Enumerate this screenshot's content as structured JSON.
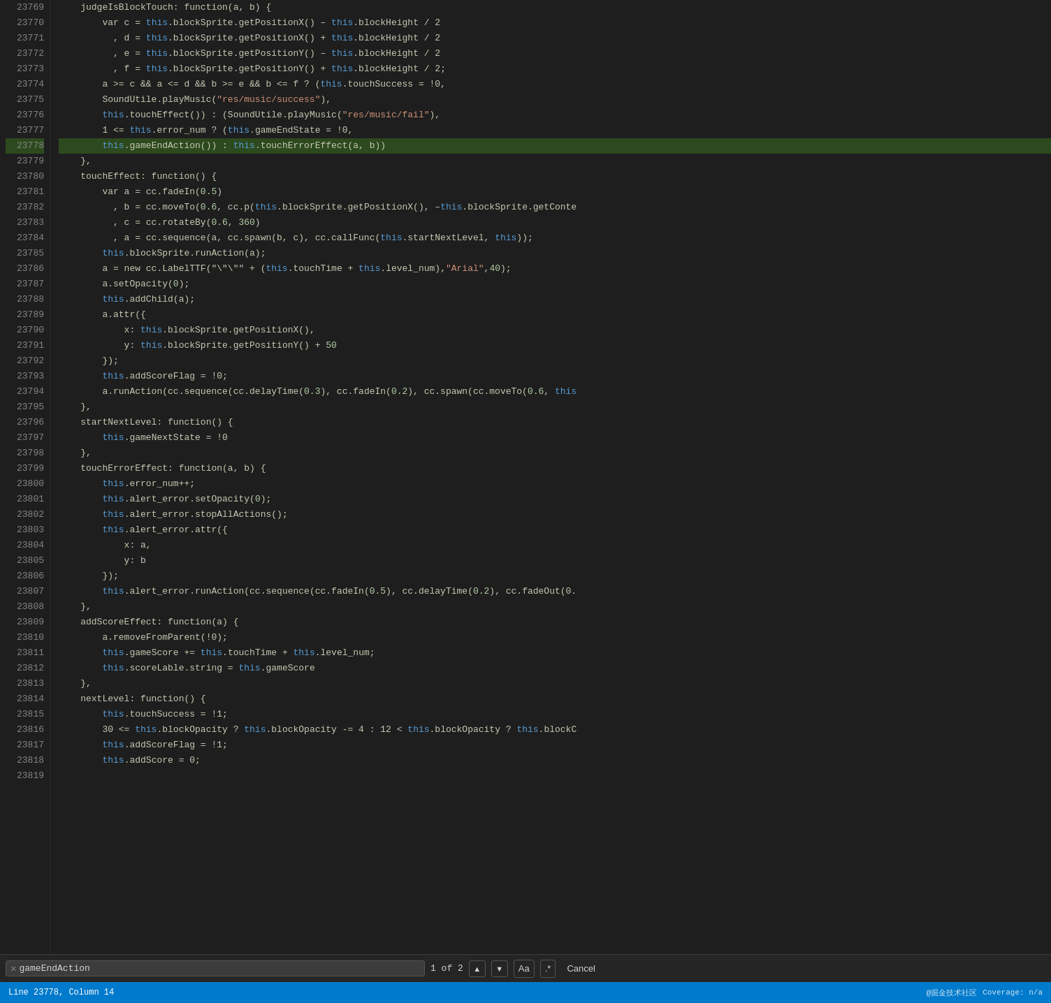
{
  "lines": [
    {
      "num": 23769,
      "tokens": [
        {
          "t": "    judgeIsBlockTouch: function(a, b) {",
          "c": ""
        }
      ]
    },
    {
      "num": 23770,
      "tokens": [
        {
          "t": "        var c = ",
          "c": ""
        },
        {
          "t": "this",
          "c": "this-kw"
        },
        {
          "t": ".blockSprite.getPositionX() – ",
          "c": ""
        },
        {
          "t": "this",
          "c": "this-kw"
        },
        {
          "t": ".blockHeight / 2",
          "c": ""
        }
      ]
    },
    {
      "num": 23771,
      "tokens": [
        {
          "t": "          , d = ",
          "c": ""
        },
        {
          "t": "this",
          "c": "this-kw"
        },
        {
          "t": ".blockSprite.getPositionX() + ",
          "c": ""
        },
        {
          "t": "this",
          "c": "this-kw"
        },
        {
          "t": ".blockHeight / 2",
          "c": ""
        }
      ]
    },
    {
      "num": 23772,
      "tokens": [
        {
          "t": "          , e = ",
          "c": ""
        },
        {
          "t": "this",
          "c": "this-kw"
        },
        {
          "t": ".blockSprite.getPositionY() – ",
          "c": ""
        },
        {
          "t": "this",
          "c": "this-kw"
        },
        {
          "t": ".blockHeight / 2",
          "c": ""
        }
      ]
    },
    {
      "num": 23773,
      "tokens": [
        {
          "t": "          , f = ",
          "c": ""
        },
        {
          "t": "this",
          "c": "this-kw"
        },
        {
          "t": ".blockSprite.getPositionY() + ",
          "c": ""
        },
        {
          "t": "this",
          "c": "this-kw"
        },
        {
          "t": ".blockHeight / 2;",
          "c": ""
        }
      ]
    },
    {
      "num": 23774,
      "tokens": [
        {
          "t": "        a >= c && a <= d && b >= e && b <= f ? (",
          "c": ""
        },
        {
          "t": "this",
          "c": "this-kw"
        },
        {
          "t": ".touchSuccess = !0,",
          "c": ""
        }
      ]
    },
    {
      "num": 23775,
      "tokens": [
        {
          "t": "        SoundUtile.playMusic(",
          "c": ""
        },
        {
          "t": "\"res/music/success\"",
          "c": "str"
        },
        {
          "t": "),",
          "c": ""
        }
      ]
    },
    {
      "num": 23776,
      "tokens": [
        {
          "t": "        ",
          "c": ""
        },
        {
          "t": "this",
          "c": "this-kw"
        },
        {
          "t": ".touchEffect()) : (SoundUtile.playMusic(",
          "c": ""
        },
        {
          "t": "\"res/music/fail\"",
          "c": "str"
        },
        {
          "t": "),",
          "c": ""
        }
      ]
    },
    {
      "num": 23777,
      "tokens": [
        {
          "t": "        1 <= ",
          "c": ""
        },
        {
          "t": "this",
          "c": "this-kw"
        },
        {
          "t": ".error_num ? (",
          "c": ""
        },
        {
          "t": "this",
          "c": "this-kw"
        },
        {
          "t": ".gameEndState = !0,",
          "c": ""
        }
      ]
    },
    {
      "num": 23778,
      "tokens": [
        {
          "t": "        ",
          "c": ""
        },
        {
          "t": "this",
          "c": "this-kw"
        },
        {
          "t": ".gameEndAction()) : ",
          "c": ""
        },
        {
          "t": "this",
          "c": "this-kw"
        },
        {
          "t": ".touchErrorEffect(a, b))",
          "c": ""
        }
      ],
      "highlighted": true
    },
    {
      "num": 23779,
      "tokens": [
        {
          "t": "    },",
          "c": ""
        }
      ]
    },
    {
      "num": 23780,
      "tokens": [
        {
          "t": "    touchEffect: function() {",
          "c": ""
        }
      ]
    },
    {
      "num": 23781,
      "tokens": [
        {
          "t": "        var a = cc.fadeIn(",
          "c": ""
        },
        {
          "t": "0.5",
          "c": "num"
        },
        {
          "t": ")",
          "c": ""
        }
      ]
    },
    {
      "num": 23782,
      "tokens": [
        {
          "t": "          , b = cc.moveTo(",
          "c": ""
        },
        {
          "t": "0.6",
          "c": "num"
        },
        {
          "t": ", cc.p(",
          "c": ""
        },
        {
          "t": "this",
          "c": "this-kw"
        },
        {
          "t": ".blockSprite.getPositionX(), –",
          "c": ""
        },
        {
          "t": "this",
          "c": "this-kw"
        },
        {
          "t": ".blockSprite.getConte",
          "c": ""
        }
      ]
    },
    {
      "num": 23783,
      "tokens": [
        {
          "t": "          , c = cc.rotateBy(",
          "c": ""
        },
        {
          "t": "0.6",
          "c": "num"
        },
        {
          "t": ", ",
          "c": ""
        },
        {
          "t": "360",
          "c": "num"
        },
        {
          "t": ")",
          "c": ""
        }
      ]
    },
    {
      "num": 23784,
      "tokens": [
        {
          "t": "          , a = cc.sequence(a, cc.spawn(b, c), cc.callFunc(",
          "c": ""
        },
        {
          "t": "this",
          "c": "this-kw"
        },
        {
          "t": ".startNextLevel, ",
          "c": ""
        },
        {
          "t": "this",
          "c": "this-kw"
        },
        {
          "t": "));",
          "c": ""
        }
      ]
    },
    {
      "num": 23785,
      "tokens": [
        {
          "t": "        ",
          "c": ""
        },
        {
          "t": "this",
          "c": "this-kw"
        },
        {
          "t": ".blockSprite.runAction(a);",
          "c": ""
        }
      ]
    },
    {
      "num": 23786,
      "tokens": [
        {
          "t": "        a = new cc.LabelTTF(",
          "c": ""
        },
        {
          "t": "\"\\\"\\\"\"",
          "c": ""
        },
        {
          "t": " + (",
          "c": ""
        },
        {
          "t": "this",
          "c": "this-kw"
        },
        {
          "t": ".touchTime + ",
          "c": ""
        },
        {
          "t": "this",
          "c": "this-kw"
        },
        {
          "t": ".level_num),",
          "c": ""
        },
        {
          "t": "\"Arial\"",
          "c": "str"
        },
        {
          "t": ",",
          "c": ""
        },
        {
          "t": "40",
          "c": "num"
        },
        {
          "t": ");",
          "c": ""
        }
      ]
    },
    {
      "num": 23787,
      "tokens": [
        {
          "t": "        a.setOpacity(",
          "c": ""
        },
        {
          "t": "0",
          "c": "num"
        },
        {
          "t": ");",
          "c": ""
        }
      ]
    },
    {
      "num": 23788,
      "tokens": [
        {
          "t": "        ",
          "c": ""
        },
        {
          "t": "this",
          "c": "this-kw"
        },
        {
          "t": ".addChild(a);",
          "c": ""
        }
      ]
    },
    {
      "num": 23789,
      "tokens": [
        {
          "t": "        a.attr({",
          "c": ""
        }
      ]
    },
    {
      "num": 23790,
      "tokens": [
        {
          "t": "            x: ",
          "c": ""
        },
        {
          "t": "this",
          "c": "this-kw"
        },
        {
          "t": ".blockSprite.getPositionX(),",
          "c": ""
        }
      ]
    },
    {
      "num": 23791,
      "tokens": [
        {
          "t": "            y: ",
          "c": ""
        },
        {
          "t": "this",
          "c": "this-kw"
        },
        {
          "t": ".blockSprite.getPositionY() + ",
          "c": ""
        },
        {
          "t": "50",
          "c": "num"
        }
      ]
    },
    {
      "num": 23792,
      "tokens": [
        {
          "t": "        });",
          "c": ""
        }
      ]
    },
    {
      "num": 23793,
      "tokens": [
        {
          "t": "        ",
          "c": ""
        },
        {
          "t": "this",
          "c": "this-kw"
        },
        {
          "t": ".addScoreFlag = !0;",
          "c": ""
        }
      ]
    },
    {
      "num": 23794,
      "tokens": [
        {
          "t": "        a.runAction(cc.sequence(cc.delayTime(",
          "c": ""
        },
        {
          "t": "0.3",
          "c": "num"
        },
        {
          "t": "), cc.fadeIn(",
          "c": ""
        },
        {
          "t": "0.2",
          "c": "num"
        },
        {
          "t": "), cc.spawn(cc.moveTo(",
          "c": ""
        },
        {
          "t": "0.6",
          "c": "num"
        },
        {
          "t": ", ",
          "c": ""
        },
        {
          "t": "this",
          "c": "this-kw"
        }
      ]
    },
    {
      "num": 23795,
      "tokens": [
        {
          "t": "    },",
          "c": ""
        }
      ]
    },
    {
      "num": 23796,
      "tokens": [
        {
          "t": "    startNextLevel: function() {",
          "c": ""
        }
      ]
    },
    {
      "num": 23797,
      "tokens": [
        {
          "t": "        ",
          "c": ""
        },
        {
          "t": "this",
          "c": "this-kw"
        },
        {
          "t": ".gameNextState = !0",
          "c": ""
        }
      ]
    },
    {
      "num": 23798,
      "tokens": [
        {
          "t": "    },",
          "c": ""
        }
      ]
    },
    {
      "num": 23799,
      "tokens": [
        {
          "t": "    touchErrorEffect: function(a, b) {",
          "c": ""
        }
      ]
    },
    {
      "num": 23800,
      "tokens": [
        {
          "t": "        ",
          "c": ""
        },
        {
          "t": "this",
          "c": "this-kw"
        },
        {
          "t": ".error_num++;",
          "c": ""
        }
      ]
    },
    {
      "num": 23801,
      "tokens": [
        {
          "t": "        ",
          "c": ""
        },
        {
          "t": "this",
          "c": "this-kw"
        },
        {
          "t": ".alert_error.setOpacity(",
          "c": ""
        },
        {
          "t": "0",
          "c": "num"
        },
        {
          "t": ");",
          "c": ""
        }
      ]
    },
    {
      "num": 23802,
      "tokens": [
        {
          "t": "        ",
          "c": ""
        },
        {
          "t": "this",
          "c": "this-kw"
        },
        {
          "t": ".alert_error.stopAllActions();",
          "c": ""
        }
      ]
    },
    {
      "num": 23803,
      "tokens": [
        {
          "t": "        ",
          "c": ""
        },
        {
          "t": "this",
          "c": "this-kw"
        },
        {
          "t": ".alert_error.attr({",
          "c": ""
        }
      ]
    },
    {
      "num": 23804,
      "tokens": [
        {
          "t": "            x: a,",
          "c": ""
        }
      ]
    },
    {
      "num": 23805,
      "tokens": [
        {
          "t": "            y: b",
          "c": ""
        }
      ]
    },
    {
      "num": 23806,
      "tokens": [
        {
          "t": "        });",
          "c": ""
        }
      ]
    },
    {
      "num": 23807,
      "tokens": [
        {
          "t": "        ",
          "c": ""
        },
        {
          "t": "this",
          "c": "this-kw"
        },
        {
          "t": ".alert_error.runAction(cc.sequence(cc.fadeIn(",
          "c": ""
        },
        {
          "t": "0.5",
          "c": "num"
        },
        {
          "t": "), cc.delayTime(",
          "c": ""
        },
        {
          "t": "0.2",
          "c": "num"
        },
        {
          "t": "), cc.fadeOut(0.",
          "c": ""
        }
      ]
    },
    {
      "num": 23808,
      "tokens": [
        {
          "t": "    },",
          "c": ""
        }
      ]
    },
    {
      "num": 23809,
      "tokens": [
        {
          "t": "    addScoreEffect: function(a) {",
          "c": ""
        }
      ]
    },
    {
      "num": 23810,
      "tokens": [
        {
          "t": "        a.removeFromParent(!0);",
          "c": ""
        }
      ]
    },
    {
      "num": 23811,
      "tokens": [
        {
          "t": "        ",
          "c": ""
        },
        {
          "t": "this",
          "c": "this-kw"
        },
        {
          "t": ".gameScore += ",
          "c": ""
        },
        {
          "t": "this",
          "c": "this-kw"
        },
        {
          "t": ".touchTime + ",
          "c": ""
        },
        {
          "t": "this",
          "c": "this-kw"
        },
        {
          "t": ".level_num;",
          "c": ""
        }
      ]
    },
    {
      "num": 23812,
      "tokens": [
        {
          "t": "        ",
          "c": ""
        },
        {
          "t": "this",
          "c": "this-kw"
        },
        {
          "t": ".scoreLable.string = ",
          "c": ""
        },
        {
          "t": "this",
          "c": "this-kw"
        },
        {
          "t": ".gameScore",
          "c": ""
        }
      ]
    },
    {
      "num": 23813,
      "tokens": [
        {
          "t": "    },",
          "c": ""
        }
      ]
    },
    {
      "num": 23814,
      "tokens": [
        {
          "t": "    nextLevel: function() {",
          "c": ""
        }
      ]
    },
    {
      "num": 23815,
      "tokens": [
        {
          "t": "        ",
          "c": ""
        },
        {
          "t": "this",
          "c": "this-kw"
        },
        {
          "t": ".touchSuccess = !1;",
          "c": ""
        }
      ]
    },
    {
      "num": 23816,
      "tokens": [
        {
          "t": "        30 <= ",
          "c": ""
        },
        {
          "t": "this",
          "c": "this-kw"
        },
        {
          "t": ".blockOpacity ? ",
          "c": ""
        },
        {
          "t": "this",
          "c": "this-kw"
        },
        {
          "t": ".blockOpacity -= 4 : 12 < ",
          "c": ""
        },
        {
          "t": "this",
          "c": "this-kw"
        },
        {
          "t": ".blockOpacity ? ",
          "c": ""
        },
        {
          "t": "this",
          "c": "this-kw"
        },
        {
          "t": ".blockC",
          "c": ""
        }
      ]
    },
    {
      "num": 23817,
      "tokens": [
        {
          "t": "        ",
          "c": ""
        },
        {
          "t": "this",
          "c": "this-kw"
        },
        {
          "t": ".addScoreFlag = !1;",
          "c": ""
        }
      ]
    },
    {
      "num": 23818,
      "tokens": [
        {
          "t": "        ",
          "c": ""
        },
        {
          "t": "this",
          "c": "this-kw"
        },
        {
          "t": ".addScore = 0;",
          "c": ""
        }
      ]
    },
    {
      "num": 23819,
      "tokens": [
        {
          "t": "",
          "c": ""
        }
      ]
    }
  ],
  "search": {
    "query": "gameEndAction",
    "count_text": "1 of 2",
    "up_label": "▲",
    "down_label": "▼",
    "aa_label": "Aa",
    "regex_label": ".*",
    "cancel_label": "Cancel"
  },
  "status": {
    "line_col": "Line 23778, Column 14",
    "right_text": "@掘金技术社区",
    "coverage": "Coverage: n/a"
  }
}
